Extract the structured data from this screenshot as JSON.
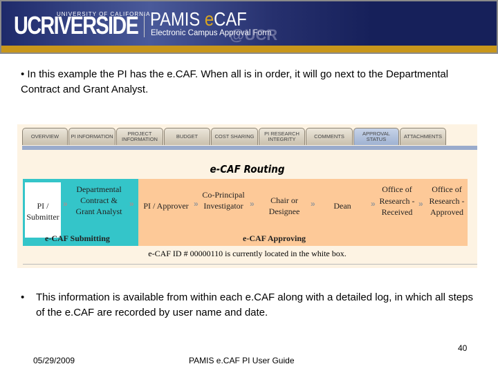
{
  "header": {
    "logo_ucr": "UCRIVERSIDE",
    "logo_uc_sub": "UNIVERSITY OF CALIFORNIA",
    "app_title_1": "PAMIS ",
    "app_title_e": "e",
    "app_title_2": "CAF",
    "subtitle": "Electronic Campus Approval Form",
    "watermark": "@UCR"
  },
  "intro": "• In this example the PI has the e.CAF. When all is in order, it will go next to the Departmental Contract and Grant Analyst.",
  "tabs": [
    {
      "label": "OVERVIEW"
    },
    {
      "label": "PI INFORMATION"
    },
    {
      "label": "PROJECT INFORMATION"
    },
    {
      "label": "BUDGET"
    },
    {
      "label": "COST SHARING"
    },
    {
      "label": "PI RESEARCH INTEGRITY"
    },
    {
      "label": "COMMENTS"
    },
    {
      "label": "APPROVAL STATUS",
      "active": true
    },
    {
      "label": "ATTACHMENTS"
    }
  ],
  "routing": {
    "title": "e-CAF Routing",
    "steps": [
      "PI / Submitter",
      "Departmental Contract & Grant Analyst",
      "PI / Approver",
      "Co-Principal Investigator",
      "Chair or Designee",
      "Dean",
      "Office of Research - Received",
      "Office of Research - Approved"
    ],
    "submitting_label": "e-CAF Submitting",
    "approving_label": "e-CAF Approving",
    "location_text": "e-CAF ID # 00000110 is currently located in the white box.",
    "colors": {
      "submitting": "#34c5c9",
      "approving": "#fdc998",
      "current": "#ffffff"
    }
  },
  "bullet": "•",
  "detail": "This information is available from within each e.CAF along with a detailed log, in which all steps of the e.CAF are recorded by user name and date.",
  "footer": {
    "page": "40",
    "date": "05/29/2009",
    "title": "PAMIS e.CAF PI User Guide"
  }
}
